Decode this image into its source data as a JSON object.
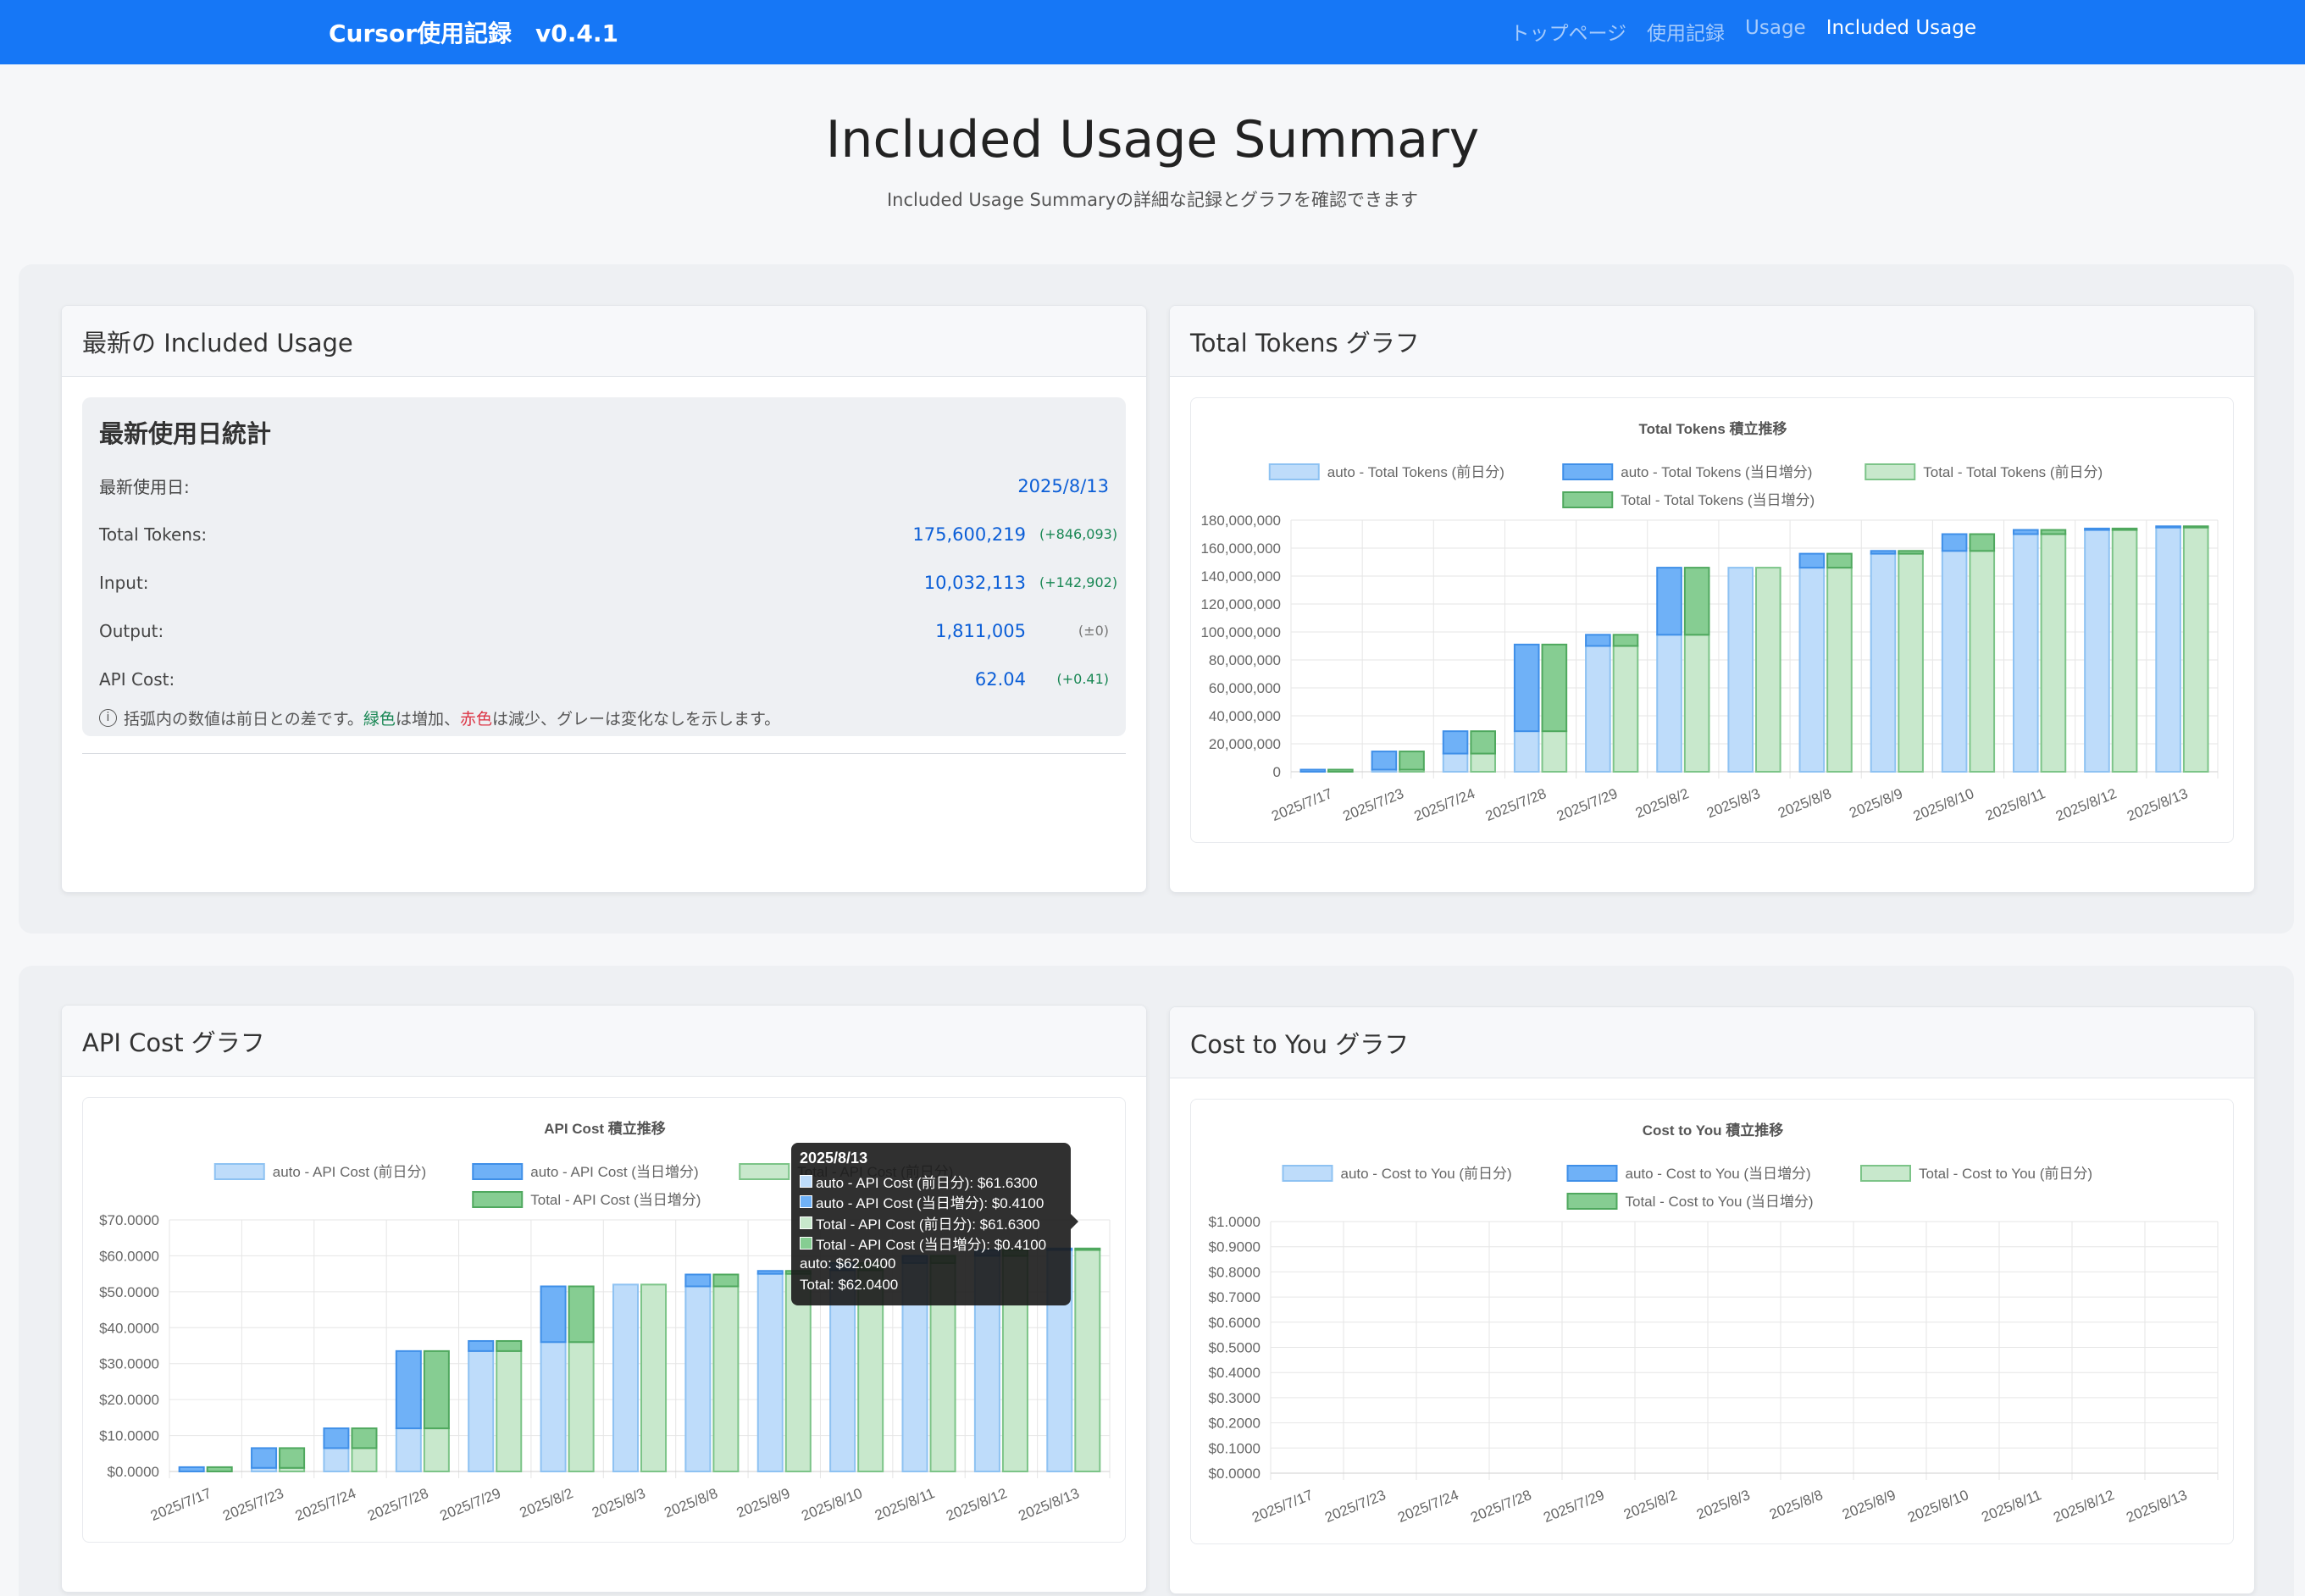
{
  "nav": {
    "brand": "Cursor使用記録　v0.4.1",
    "links": [
      {
        "label": "トップページ",
        "active": false
      },
      {
        "label": "使用記録",
        "active": false
      },
      {
        "label": "Usage",
        "active": false
      },
      {
        "label": "Included Usage",
        "active": true
      }
    ]
  },
  "header": {
    "title": "Included Usage Summary",
    "subtitle": "Included Usage Summaryの詳細な記録とグラフを確認できます"
  },
  "latest_card": {
    "title": "最新の Included Usage",
    "box_title": "最新使用日統計",
    "rows": [
      {
        "label": "最新使用日:",
        "value": "2025/8/13",
        "delta": ""
      },
      {
        "label": "Total Tokens:",
        "value": "175,600,219",
        "delta": "(+846,093)"
      },
      {
        "label": "Input:",
        "value": "10,032,113",
        "delta": "(+142,902)"
      },
      {
        "label": "Output:",
        "value": "1,811,005",
        "delta": "(±0)"
      },
      {
        "label": "API Cost:",
        "value": "62.04",
        "delta": "(+0.41)"
      }
    ],
    "note_pre": "括弧内の数値は前日との差です。",
    "note_green": "緑色",
    "note_mid": "は増加、",
    "note_red": "赤色",
    "note_post": "は減少、グレーは変化なしを示します。"
  },
  "colors": {
    "navbar": "#1677f6",
    "auto_prev": "#bedcfa",
    "auto_prev_border": "#8ec2f2",
    "auto_inc": "#6fb1f7",
    "auto_inc_border": "#3f8fe8",
    "total_prev": "#c8e8cc",
    "total_prev_border": "#7cc488",
    "total_inc": "#86cd92",
    "total_inc_border": "#4fa85e"
  },
  "chart_data": [
    {
      "id": "tokens",
      "card_title": "Total Tokens グラフ",
      "type": "bar",
      "title": "Total Tokens 積立推移",
      "categories": [
        "2025/7/17",
        "2025/7/23",
        "2025/7/24",
        "2025/7/28",
        "2025/7/29",
        "2025/8/2",
        "2025/8/3",
        "2025/8/8",
        "2025/8/9",
        "2025/8/10",
        "2025/8/11",
        "2025/8/12",
        "2025/8/13"
      ],
      "ylim": [
        0,
        180000000
      ],
      "y_ticks": [
        "0",
        "20,000,000",
        "40,000,000",
        "60,000,000",
        "80,000,000",
        "100,000,000",
        "120,000,000",
        "140,000,000",
        "160,000,000",
        "180,000,000"
      ],
      "series": [
        {
          "name": "auto - Total Tokens (前日分)",
          "stack": "auto",
          "values": [
            0,
            1500000,
            13000000,
            29000000,
            90000000,
            98000000,
            146000000,
            146000000,
            156000000,
            158000000,
            170000000,
            173000000,
            174754126
          ]
        },
        {
          "name": "auto - Total Tokens (当日増分)",
          "stack": "auto",
          "values": [
            1500000,
            13000000,
            16000000,
            62000000,
            8000000,
            48000000,
            0,
            10000000,
            2000000,
            12000000,
            3000000,
            1000000,
            846093
          ]
        },
        {
          "name": "Total - Total Tokens (前日分)",
          "stack": "total",
          "values": [
            0,
            1500000,
            13000000,
            29000000,
            90000000,
            98000000,
            146000000,
            146000000,
            156000000,
            158000000,
            170000000,
            173000000,
            174754126
          ]
        },
        {
          "name": "Total - Total Tokens (当日増分)",
          "stack": "total",
          "values": [
            1500000,
            13000000,
            16000000,
            62000000,
            8000000,
            48000000,
            0,
            10000000,
            2000000,
            12000000,
            3000000,
            1000000,
            846093
          ]
        }
      ]
    },
    {
      "id": "apicost",
      "card_title": "API Cost グラフ",
      "type": "bar",
      "title": "API Cost 積立推移",
      "categories": [
        "2025/7/17",
        "2025/7/23",
        "2025/7/24",
        "2025/7/28",
        "2025/7/29",
        "2025/8/2",
        "2025/8/3",
        "2025/8/8",
        "2025/8/9",
        "2025/8/10",
        "2025/8/11",
        "2025/8/12",
        "2025/8/13"
      ],
      "ylim": [
        0,
        70
      ],
      "y_ticks": [
        "$0.0000",
        "$10.0000",
        "$20.0000",
        "$30.0000",
        "$40.0000",
        "$50.0000",
        "$60.0000",
        "$70.0000"
      ],
      "series": [
        {
          "name": "auto - API Cost (前日分)",
          "stack": "auto",
          "values": [
            0,
            1,
            6.5,
            12,
            33.5,
            36,
            52,
            51.5,
            55,
            56,
            58,
            60,
            61.63
          ]
        },
        {
          "name": "auto - API Cost (当日増分)",
          "stack": "auto",
          "values": [
            1.2,
            5.5,
            5.5,
            21.5,
            2.8,
            15.5,
            0,
            3.3,
            0.8,
            2,
            2,
            1.6,
            0.41
          ]
        },
        {
          "name": "Total - API Cost (前日分)",
          "stack": "total",
          "values": [
            0,
            1,
            6.5,
            12,
            33.5,
            36,
            52,
            51.5,
            55,
            56,
            58,
            60,
            61.63
          ]
        },
        {
          "name": "Total - API Cost (当日増分)",
          "stack": "total",
          "values": [
            1.2,
            5.5,
            5.5,
            21.5,
            2.8,
            15.5,
            0,
            3.3,
            0.8,
            2,
            2,
            1.6,
            0.41
          ]
        }
      ],
      "tooltip": {
        "title": "2025/8/13",
        "lines": [
          "auto - API Cost (前日分): $61.6300",
          "auto - API Cost (当日増分): $0.4100",
          "Total - API Cost (前日分): $61.6300",
          "Total - API Cost (当日増分): $0.4100"
        ],
        "footer": [
          "auto: $62.0400",
          "Total: $62.0400"
        ]
      }
    },
    {
      "id": "costtoyou",
      "card_title": "Cost to You グラフ",
      "type": "bar",
      "title": "Cost to You 積立推移",
      "categories": [
        "2025/7/17",
        "2025/7/23",
        "2025/7/24",
        "2025/7/28",
        "2025/7/29",
        "2025/8/2",
        "2025/8/3",
        "2025/8/8",
        "2025/8/9",
        "2025/8/10",
        "2025/8/11",
        "2025/8/12",
        "2025/8/13"
      ],
      "ylim": [
        0,
        1
      ],
      "y_ticks": [
        "$0.0000",
        "$0.1000",
        "$0.2000",
        "$0.3000",
        "$0.4000",
        "$0.5000",
        "$0.6000",
        "$0.7000",
        "$0.8000",
        "$0.9000",
        "$1.0000"
      ],
      "series": [
        {
          "name": "auto - Cost to You (前日分)",
          "stack": "auto",
          "values": [
            0,
            0,
            0,
            0,
            0,
            0,
            0,
            0,
            0,
            0,
            0,
            0,
            0
          ]
        },
        {
          "name": "auto - Cost to You (当日増分)",
          "stack": "auto",
          "values": [
            0,
            0,
            0,
            0,
            0,
            0,
            0,
            0,
            0,
            0,
            0,
            0,
            0
          ]
        },
        {
          "name": "Total - Cost to You (前日分)",
          "stack": "total",
          "values": [
            0,
            0,
            0,
            0,
            0,
            0,
            0,
            0,
            0,
            0,
            0,
            0,
            0
          ]
        },
        {
          "name": "Total - Cost to You (当日増分)",
          "stack": "total",
          "values": [
            0,
            0,
            0,
            0,
            0,
            0,
            0,
            0,
            0,
            0,
            0,
            0,
            0
          ]
        }
      ]
    }
  ]
}
